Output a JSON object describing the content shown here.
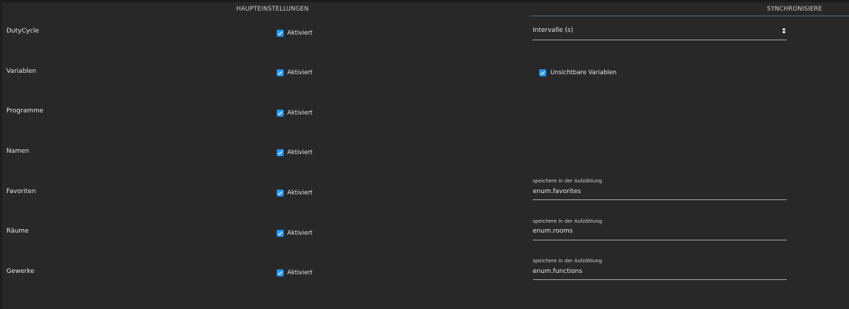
{
  "tabs": {
    "main": "HAUPTEINSTELLUNGEN",
    "sync": "SYNCHRONISIERE"
  },
  "rows": [
    {
      "label": "DutyCycle",
      "checkbox_label": "Aktiviert",
      "checked": true
    },
    {
      "label": "Variablen",
      "checkbox_label": "Aktiviert",
      "checked": true
    },
    {
      "label": "Programme",
      "checkbox_label": "Aktiviert",
      "checked": true
    },
    {
      "label": "Namen",
      "checkbox_label": "Aktiviert",
      "checked": true
    },
    {
      "label": "Favoriten",
      "checkbox_label": "Aktiviert",
      "checked": true
    },
    {
      "label": "Räume",
      "checkbox_label": "Aktiviert",
      "checked": true
    },
    {
      "label": "Gewerke",
      "checkbox_label": "Aktiviert",
      "checked": true
    }
  ],
  "interval": {
    "label": "Intervalle (s)",
    "value": ""
  },
  "invisible_variables": {
    "label": "Unsichtbare Variablen",
    "checked": true
  },
  "enum_fields": [
    {
      "label": "speichere in der Aufzählung",
      "value": "enum.favorites"
    },
    {
      "label": "speichere in der Aufzählung",
      "value": "enum.rooms"
    },
    {
      "label": "speichere in der Aufzählung",
      "value": "enum.functions"
    }
  ],
  "colors": {
    "background": "#282828",
    "checkbox": "#2196f3",
    "tab_underline": "#4a6f8a"
  }
}
